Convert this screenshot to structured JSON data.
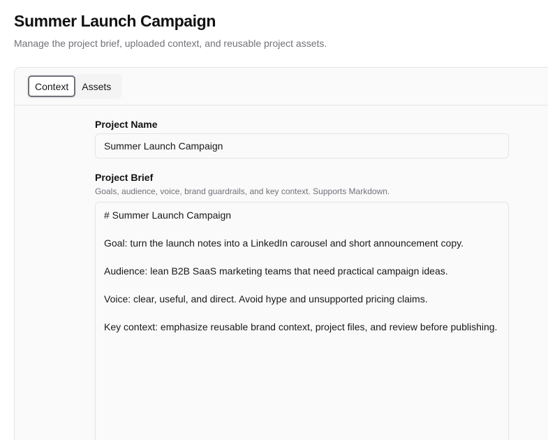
{
  "header": {
    "title": "Summer Launch Campaign",
    "subtitle": "Manage the project brief, uploaded context, and reusable project assets."
  },
  "tabs": [
    {
      "label": "Context",
      "active": true
    },
    {
      "label": "Assets",
      "active": false
    }
  ],
  "form": {
    "project_name": {
      "label": "Project Name",
      "value": "Summer Launch Campaign"
    },
    "project_brief": {
      "label": "Project Brief",
      "hint": "Goals, audience, voice, brand guardrails, and key context. Supports Markdown.",
      "value": "# Summer Launch Campaign\n\nGoal: turn the launch notes into a LinkedIn carousel and short announcement copy.\n\nAudience: lean B2B SaaS marketing teams that need practical campaign ideas.\n\nVoice: clear, useful, and direct. Avoid hype and unsupported pricing claims.\n\nKey context: emphasize reusable brand context, project files, and review before publishing."
    }
  },
  "colors": {
    "text": "#18181b",
    "muted": "#71717a",
    "border": "#e4e4e7",
    "surface": "#fafafa",
    "tab_track": "#f4f4f5"
  }
}
